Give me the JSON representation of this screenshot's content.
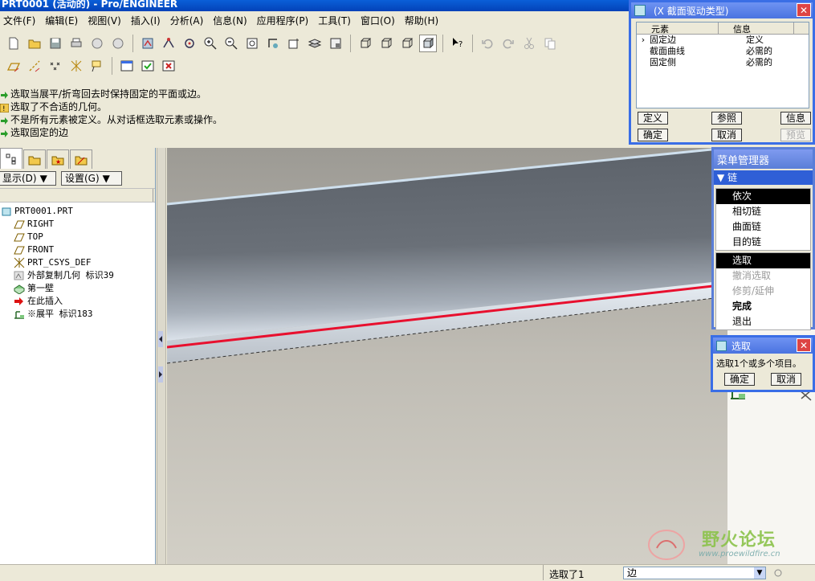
{
  "window_title": "PRT0001 (活动的) - Pro/ENGINEER",
  "menu": [
    "文件(F)",
    "编辑(E)",
    "视图(V)",
    "插入(I)",
    "分析(A)",
    "信息(N)",
    "应用程序(P)",
    "工具(T)",
    "窗口(O)",
    "帮助(H)"
  ],
  "messages": [
    {
      "icon": "green-arrow-icon",
      "text": "选取当展平/折弯回去时保持固定的平面或边。"
    },
    {
      "icon": "warning-icon",
      "text": "选取了不合适的几何。"
    },
    {
      "icon": "green-arrow-icon",
      "text": "不是所有元素被定义。从对话框选取元素或操作。"
    },
    {
      "icon": "green-arrow-icon",
      "text": "选取固定的边"
    }
  ],
  "left_panel": {
    "show_btn": "显示(D)",
    "settings_btn": "设置(G)",
    "tree": [
      {
        "icon": "part-icon",
        "label": "PRT0001.PRT",
        "indent": 0
      },
      {
        "icon": "datum-plane-icon",
        "label": "RIGHT",
        "indent": 1
      },
      {
        "icon": "datum-plane-icon",
        "label": "TOP",
        "indent": 1
      },
      {
        "icon": "datum-plane-icon",
        "label": "FRONT",
        "indent": 1
      },
      {
        "icon": "csys-icon",
        "label": "PRT_CSYS_DEF",
        "indent": 1
      },
      {
        "icon": "copy-geom-icon",
        "label": "外部复制几何 标识39",
        "indent": 1
      },
      {
        "icon": "first-wall-icon",
        "label": "第一壁",
        "indent": 1
      },
      {
        "icon": "insert-here-icon",
        "label": "在此插入",
        "indent": 1
      },
      {
        "icon": "unbend-icon",
        "label": "※展平 标识183",
        "indent": 1
      }
    ]
  },
  "section_dialog": {
    "title": "(X 截面驱动类型)",
    "col_element": "元素",
    "col_info": "信息",
    "rows": [
      {
        "element": "固定边",
        "info": "定义",
        "current": true
      },
      {
        "element": "截面曲线",
        "info": "必需的",
        "current": false
      },
      {
        "element": "固定侧",
        "info": "必需的",
        "current": false
      }
    ],
    "btn_define": "定义",
    "btn_reference": "参照",
    "btn_info": "信息",
    "btn_ok": "确定",
    "btn_cancel": "取消",
    "btn_preview": "预览"
  },
  "menu_manager": {
    "title": "菜单管理器",
    "header": "链",
    "items": [
      {
        "label": "依次",
        "state": "highlight"
      },
      {
        "label": "相切链",
        "state": "normal"
      },
      {
        "label": "曲面链",
        "state": "normal"
      },
      {
        "label": "目的链",
        "state": "normal"
      },
      {
        "label": "选取",
        "state": "highlight"
      },
      {
        "label": "撤消选取",
        "state": "disabled"
      },
      {
        "label": "修剪/延伸",
        "state": "disabled"
      },
      {
        "label": "完成",
        "state": "bold"
      },
      {
        "label": "退出",
        "state": "normal"
      }
    ]
  },
  "select_dialog": {
    "title": "选取",
    "prompt": "选取1个或多个项目。",
    "btn_ok": "确定",
    "btn_cancel": "取消"
  },
  "status": {
    "selected": "选取了1",
    "filter": "边"
  },
  "watermark": {
    "text": "野火论坛",
    "url": "www.proewildfire.cn"
  },
  "colors": {
    "title_blue": "#0a5fd8",
    "dialog_border": "#3a6ee6",
    "highlight_edge": "#e8102e",
    "model_gray": "#5e646c"
  }
}
